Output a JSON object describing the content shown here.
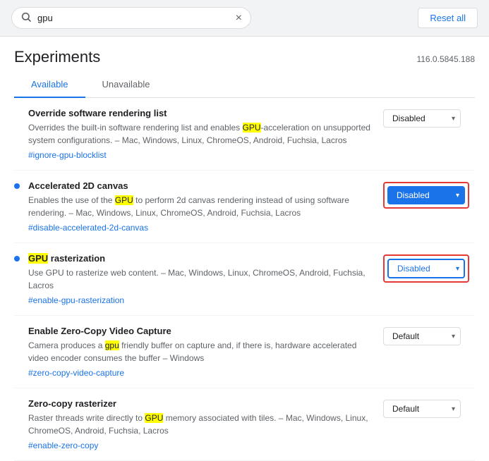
{
  "search": {
    "value": "gpu",
    "placeholder": "Search flags",
    "clear_label": "×"
  },
  "reset_button": "Reset all",
  "title": "Experiments",
  "version": "116.0.5845.188",
  "tabs": [
    {
      "label": "Available",
      "active": true
    },
    {
      "label": "Unavailable",
      "active": false
    }
  ],
  "experiments": [
    {
      "id": "override-software-rendering",
      "has_dot": false,
      "title": "Override software rendering list",
      "desc_parts": [
        "Overrides the built-in software rendering list and enables ",
        "GPU",
        "-acceleration on unsupported system configurations. – Mac, Windows, Linux, ChromeOS, Android, Fuchsia, Lacros"
      ],
      "link": "#ignore-gpu-blocklist",
      "control_type": "default",
      "control_value": "Disabled"
    },
    {
      "id": "accelerated-2d-canvas",
      "has_dot": true,
      "title": "Accelerated 2D canvas",
      "desc_parts": [
        "Enables the use of the ",
        "GPU",
        " to perform 2d canvas rendering instead of using software rendering. – Mac, Windows, Linux, ChromeOS, Android, Fuchsia, Lacros"
      ],
      "link": "#disable-accelerated-2d-canvas",
      "control_type": "blue",
      "control_value": "Disabled",
      "red_box": true
    },
    {
      "id": "gpu-rasterization",
      "has_dot": true,
      "title": "GPU rasterization",
      "desc_parts": [
        "Use GPU to rasterize web content. – Mac, Windows, Linux, ChromeOS, Android, Fuchsia, Lacros"
      ],
      "link": "#enable-gpu-rasterization",
      "control_type": "blue-outlined",
      "control_value": "Disabled",
      "red_box": true
    },
    {
      "id": "zero-copy-video-capture",
      "has_dot": false,
      "title": "Enable Zero-Copy Video Capture",
      "desc_parts": [
        "Camera produces a ",
        "gpu",
        " friendly buffer on capture and, if there is, hardware accelerated video encoder consumes the buffer – Windows"
      ],
      "link": "#zero-copy-video-capture",
      "control_type": "default",
      "control_value": "Default"
    },
    {
      "id": "zero-copy-rasterizer",
      "has_dot": false,
      "title": "Zero-copy rasterizer",
      "desc_parts": [
        "Raster threads write directly to ",
        "GPU",
        " memory associated with tiles. – Mac, Windows, Linux, ChromeOS, Android, Fuchsia, Lacros"
      ],
      "link": "#enable-zero-copy",
      "control_type": "default",
      "control_value": "Default"
    }
  ]
}
